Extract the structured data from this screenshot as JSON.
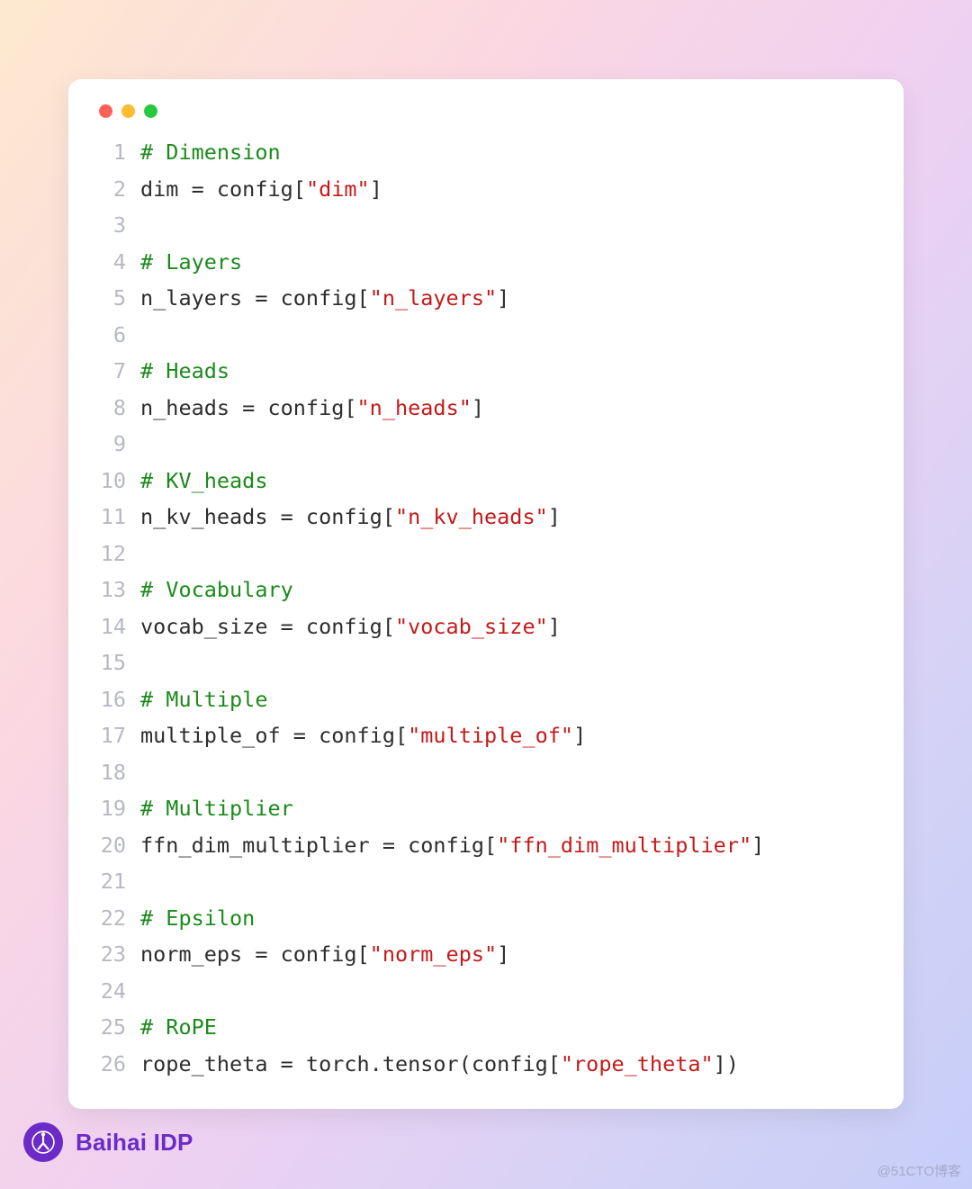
{
  "window": {
    "dots": [
      "red",
      "yellow",
      "green"
    ]
  },
  "colors": {
    "comment": "#1c8a1c",
    "string": "#c41a1a",
    "text": "#2d2d2d",
    "lineno": "#b7b9c2",
    "brand": "#6b2bc9"
  },
  "code_lines": [
    {
      "tokens": [
        {
          "t": "# Dimension",
          "c": "comment"
        }
      ]
    },
    {
      "tokens": [
        {
          "t": "dim = config[",
          "c": "text"
        },
        {
          "t": "\"dim\"",
          "c": "string"
        },
        {
          "t": "]",
          "c": "text"
        }
      ]
    },
    {
      "tokens": []
    },
    {
      "tokens": [
        {
          "t": "# Layers",
          "c": "comment"
        }
      ]
    },
    {
      "tokens": [
        {
          "t": "n_layers = config[",
          "c": "text"
        },
        {
          "t": "\"n_layers\"",
          "c": "string"
        },
        {
          "t": "]",
          "c": "text"
        }
      ]
    },
    {
      "tokens": []
    },
    {
      "tokens": [
        {
          "t": "# Heads",
          "c": "comment"
        }
      ]
    },
    {
      "tokens": [
        {
          "t": "n_heads = config[",
          "c": "text"
        },
        {
          "t": "\"n_heads\"",
          "c": "string"
        },
        {
          "t": "]",
          "c": "text"
        }
      ]
    },
    {
      "tokens": []
    },
    {
      "tokens": [
        {
          "t": "# KV_heads",
          "c": "comment"
        }
      ]
    },
    {
      "tokens": [
        {
          "t": "n_kv_heads = config[",
          "c": "text"
        },
        {
          "t": "\"n_kv_heads\"",
          "c": "string"
        },
        {
          "t": "]",
          "c": "text"
        }
      ]
    },
    {
      "tokens": []
    },
    {
      "tokens": [
        {
          "t": "# Vocabulary",
          "c": "comment"
        }
      ]
    },
    {
      "tokens": [
        {
          "t": "vocab_size = config[",
          "c": "text"
        },
        {
          "t": "\"vocab_size\"",
          "c": "string"
        },
        {
          "t": "]",
          "c": "text"
        }
      ]
    },
    {
      "tokens": []
    },
    {
      "tokens": [
        {
          "t": "# Multiple",
          "c": "comment"
        }
      ]
    },
    {
      "tokens": [
        {
          "t": "multiple_of = config[",
          "c": "text"
        },
        {
          "t": "\"multiple_of\"",
          "c": "string"
        },
        {
          "t": "]",
          "c": "text"
        }
      ]
    },
    {
      "tokens": []
    },
    {
      "tokens": [
        {
          "t": "# Multiplier",
          "c": "comment"
        }
      ]
    },
    {
      "tokens": [
        {
          "t": "ffn_dim_multiplier = config[",
          "c": "text"
        },
        {
          "t": "\"ffn_dim_multiplier\"",
          "c": "string"
        },
        {
          "t": "]",
          "c": "text"
        }
      ]
    },
    {
      "tokens": []
    },
    {
      "tokens": [
        {
          "t": "# Epsilon",
          "c": "comment"
        }
      ]
    },
    {
      "tokens": [
        {
          "t": "norm_eps = config[",
          "c": "text"
        },
        {
          "t": "\"norm_eps\"",
          "c": "string"
        },
        {
          "t": "]",
          "c": "text"
        }
      ]
    },
    {
      "tokens": []
    },
    {
      "tokens": [
        {
          "t": "# RoPE",
          "c": "comment"
        }
      ]
    },
    {
      "tokens": [
        {
          "t": "rope_theta = torch.tensor(config[",
          "c": "text"
        },
        {
          "t": "\"rope_theta\"",
          "c": "string"
        },
        {
          "t": "])",
          "c": "text"
        }
      ]
    }
  ],
  "footer": {
    "brand": "Baihai IDP"
  },
  "watermark": "@51CTO博客"
}
